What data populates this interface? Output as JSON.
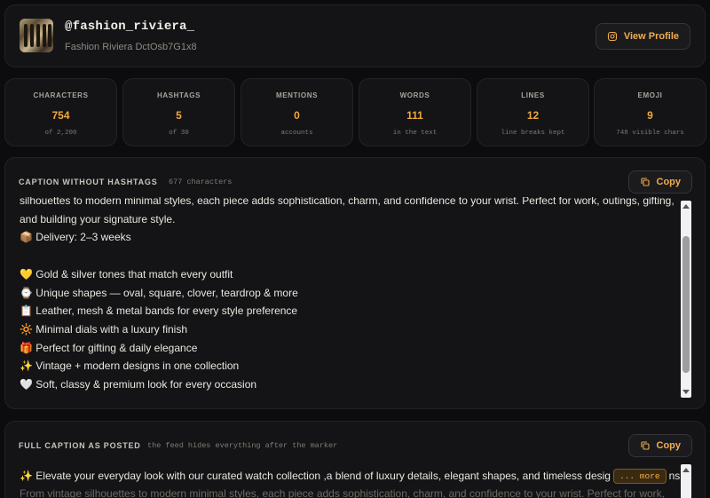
{
  "profile": {
    "handle": "@fashion_riviera_",
    "name": "Fashion Riviera DctOsb7G1x8",
    "view_label": "View Profile"
  },
  "stats": [
    {
      "label": "CHARACTERS",
      "value": "754",
      "sub": "of 2,200"
    },
    {
      "label": "HASHTAGS",
      "value": "5",
      "sub": "of 30"
    },
    {
      "label": "MENTIONS",
      "value": "0",
      "sub": "accounts"
    },
    {
      "label": "WORDS",
      "value": "111",
      "sub": "in the text"
    },
    {
      "label": "LINES",
      "value": "12",
      "sub": "line breaks kept"
    },
    {
      "label": "EMOJI",
      "value": "9",
      "sub": "748 visible chars"
    }
  ],
  "caption_no_tags": {
    "title": "CAPTION WITHOUT HASHTAGS",
    "note": "677 characters",
    "copy_label": "Copy",
    "lines": [
      "silhouettes to modern minimal styles, each piece adds sophistication, charm, and confidence to your wrist. Perfect for work, outings, gifting,",
      "and building your signature style.",
      "📦 Delivery: 2–3 weeks",
      "",
      "💛 Gold & silver tones that match every outfit",
      "⌚ Unique shapes — oval, square, clover, teardrop & more",
      "📋 Leather, mesh & metal bands for every style preference",
      "🔆 Minimal dials with a luxury finish",
      "🎁 Perfect for gifting & daily elegance",
      "✨ Vintage + modern designs in one collection",
      "🤍 Soft, classy & premium look for every occasion"
    ]
  },
  "caption_full": {
    "title": "FULL CAPTION AS POSTED",
    "note": "the feed hides everything after the marker",
    "copy_label": "Copy",
    "line_before": "✨ Elevate your everyday look with our curated watch collection ,a blend of luxury details, elegant shapes, and timeless desig",
    "marker": "... more",
    "line_after": "ns.",
    "hidden_line": "From vintage silhouettes to modern minimal styles, each piece adds sophistication, charm, and confidence to your wrist. Perfect for work,"
  },
  "colors": {
    "accent": "#f0a83c",
    "background": "#0c0c0e",
    "card": "#141416"
  },
  "icons": {
    "view_profile": "instagram-icon",
    "copy": "copy-icon"
  }
}
